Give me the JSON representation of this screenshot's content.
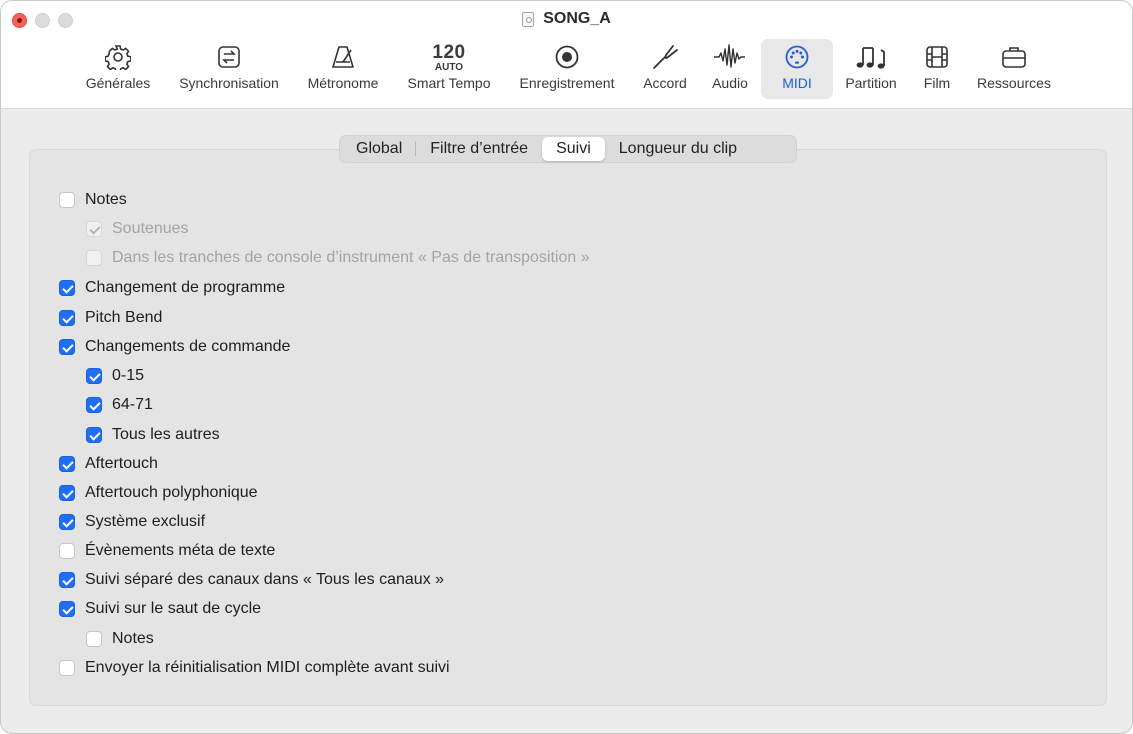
{
  "window": {
    "title": "SONG_A"
  },
  "toolbar": {
    "items": [
      {
        "label": "Générales",
        "icon": "gear-icon"
      },
      {
        "label": "Synchronisation",
        "icon": "sync-icon"
      },
      {
        "label": "Métronome",
        "icon": "metronome-icon"
      },
      {
        "label": "Smart Tempo",
        "icon": "tempo-icon",
        "tempo_value": "120",
        "tempo_mode": "AUTO"
      },
      {
        "label": "Enregistrement",
        "icon": "record-icon"
      },
      {
        "label": "Accord",
        "icon": "tuning-fork-icon"
      },
      {
        "label": "Audio",
        "icon": "waveform-icon"
      },
      {
        "label": "MIDI",
        "icon": "midi-port-icon"
      },
      {
        "label": "Partition",
        "icon": "notes-icon"
      },
      {
        "label": "Film",
        "icon": "film-icon"
      },
      {
        "label": "Ressources",
        "icon": "briefcase-icon"
      }
    ],
    "active": "MIDI"
  },
  "tabs": {
    "items": [
      "Global",
      "Filtre d’entrée",
      "Suivi",
      "Longueur du clip"
    ],
    "active": "Suivi"
  },
  "options": [
    {
      "label": "Notes",
      "checked": false,
      "enabled": true
    },
    {
      "label": "Soutenues",
      "checked": true,
      "enabled": false
    },
    {
      "label": "Dans les tranches de console d’instrument « Pas de transposition »",
      "checked": false,
      "enabled": false
    },
    {
      "label": "Changement de programme",
      "checked": true,
      "enabled": true
    },
    {
      "label": "Pitch Bend",
      "checked": true,
      "enabled": true
    },
    {
      "label": "Changements de commande",
      "checked": true,
      "enabled": true
    },
    {
      "label": "0-15",
      "checked": true,
      "enabled": true
    },
    {
      "label": "64-71",
      "checked": true,
      "enabled": true
    },
    {
      "label": "Tous les autres",
      "checked": true,
      "enabled": true
    },
    {
      "label": "Aftertouch",
      "checked": true,
      "enabled": true
    },
    {
      "label": "Aftertouch polyphonique",
      "checked": true,
      "enabled": true
    },
    {
      "label": "Système exclusif",
      "checked": true,
      "enabled": true
    },
    {
      "label": "Évènements méta de texte",
      "checked": false,
      "enabled": true
    },
    {
      "label": "Suivi séparé des canaux dans « Tous les canaux »",
      "checked": true,
      "enabled": true
    },
    {
      "label": "Suivi sur le saut de cycle",
      "checked": true,
      "enabled": true
    },
    {
      "label": "Notes",
      "checked": false,
      "enabled": true
    },
    {
      "label": "Envoyer la réinitialisation MIDI complète avant suivi",
      "checked": false,
      "enabled": true
    }
  ],
  "colors": {
    "accent": "#1f6ef4",
    "active_toolbar_text": "#1f5fd1"
  }
}
